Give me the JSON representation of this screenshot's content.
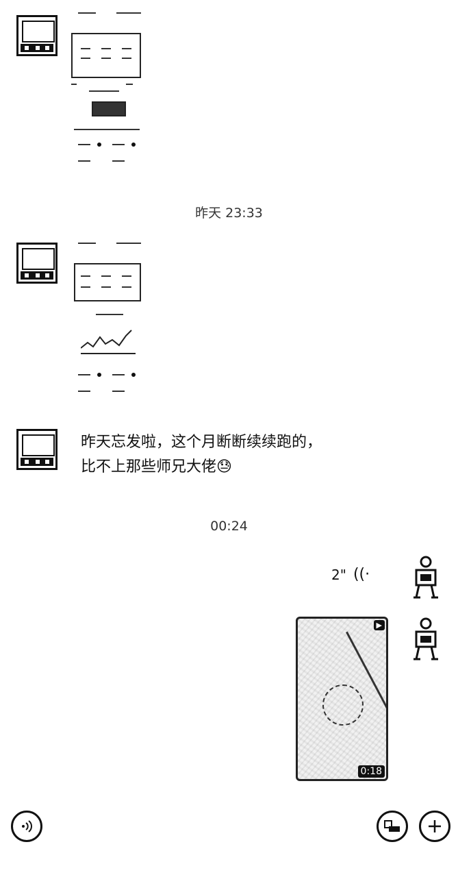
{
  "messages": {
    "timestamp_1": "昨天 23:33",
    "text_line_1": "昨天忘发啦，这个月断断续续跑的，",
    "text_line_2": "比不上那些师兄大佬",
    "text_emoji": "😓",
    "timestamp_2": "00:24",
    "voice_duration": "2\"",
    "video_badge": "▶",
    "video_duration": "0:18"
  },
  "icons": {
    "voice_wave": "wave-icon",
    "voice_toggle": "voice-input-icon",
    "sticker": "sticker-icon",
    "plus": "plus-icon"
  }
}
